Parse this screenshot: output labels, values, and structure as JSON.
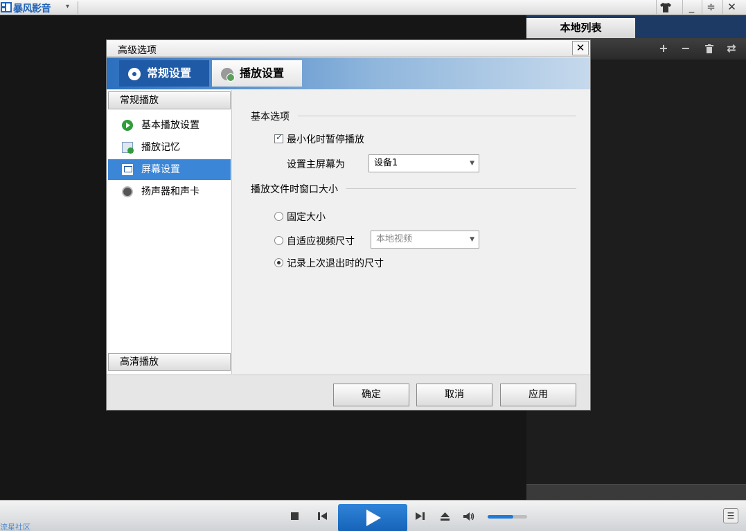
{
  "app": {
    "title": "暴风影音",
    "menu_arrow": "▾",
    "window_controls": [
      "skin-icon",
      "minimize-icon",
      "restore-icon",
      "close-icon"
    ]
  },
  "playlist": {
    "tab_label": "本地列表",
    "tools": [
      "add-icon",
      "remove-icon",
      "delete-icon",
      "loop-icon"
    ]
  },
  "controls": {
    "community_link": "流星社区",
    "buttons": [
      "stop-icon",
      "prev-icon",
      "play-icon",
      "next-icon",
      "eject-icon",
      "volume-icon"
    ],
    "volume_level": 0.65
  },
  "dialog": {
    "title": "高级选项",
    "tabs": [
      {
        "label": "常规设置",
        "icon": "gear-icon",
        "active": true
      },
      {
        "label": "播放设置",
        "icon": "play-settings-icon",
        "active": false
      }
    ],
    "nav": {
      "group_top": "常规播放",
      "items": [
        {
          "label": "基本播放设置",
          "icon": "play-circle-icon"
        },
        {
          "label": "播放记忆",
          "icon": "memory-icon"
        },
        {
          "label": "屏幕设置",
          "icon": "screen-icon",
          "active": true
        },
        {
          "label": "扬声器和声卡",
          "icon": "speaker-icon"
        }
      ],
      "group_bottom": "高清播放"
    },
    "content": {
      "section_basic": "基本选项",
      "checkbox_pause_minimized": {
        "label": "最小化时暂停播放",
        "checked": true
      },
      "primary_screen_label": "设置主屏幕为",
      "primary_screen_value": "设备1",
      "section_window_size": "播放文件时窗口大小",
      "radio_fixed": {
        "label": "固定大小",
        "checked": false
      },
      "radio_adaptive": {
        "label": "自适应视频尺寸",
        "checked": false
      },
      "adaptive_select_value": "本地视频",
      "radio_last_size": {
        "label": "记录上次退出时的尺寸",
        "checked": true
      }
    },
    "footer": {
      "ok": "确定",
      "cancel": "取消",
      "apply": "应用"
    }
  }
}
